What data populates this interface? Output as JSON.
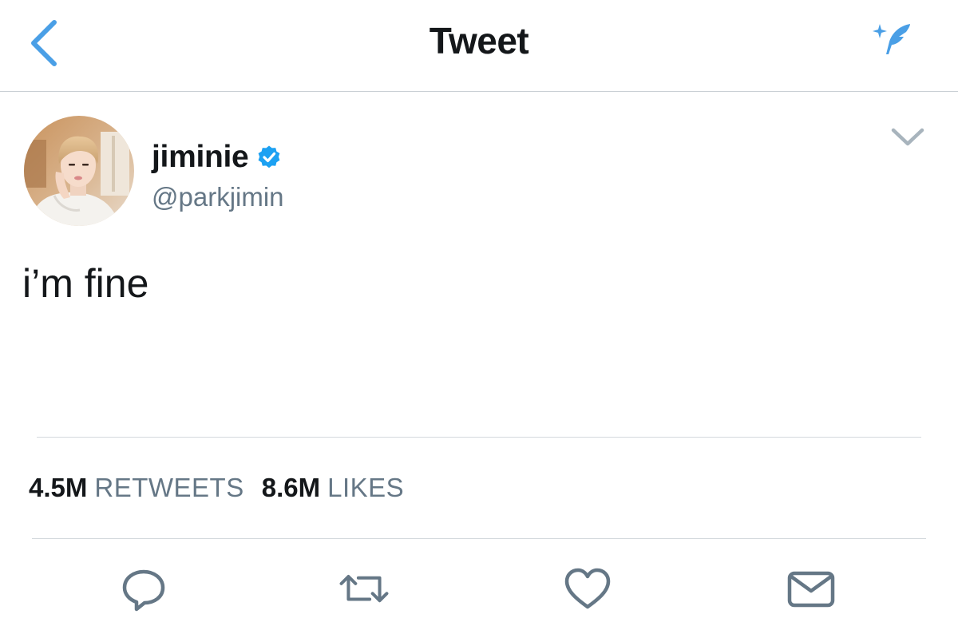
{
  "header": {
    "title": "Tweet",
    "back_icon": "chevron-left-icon",
    "compose_icon": "compose-tweet-icon"
  },
  "tweet": {
    "display_name": "jiminie",
    "verified": true,
    "handle": "@parkjimin",
    "text": "i’m fine"
  },
  "stats": {
    "retweets_count": "4.5M",
    "retweets_label": "RETWEETS",
    "likes_count": "8.6M",
    "likes_label": "LIKES"
  },
  "actions": [
    "reply-icon",
    "retweet-icon",
    "like-icon",
    "direct-message-icon"
  ],
  "colors": {
    "accent": "#4a9fe6",
    "verified": "#1da1f2",
    "text_primary": "#14171a",
    "text_secondary": "#657786",
    "divider": "#d4d9dd",
    "icon": "#657786"
  }
}
